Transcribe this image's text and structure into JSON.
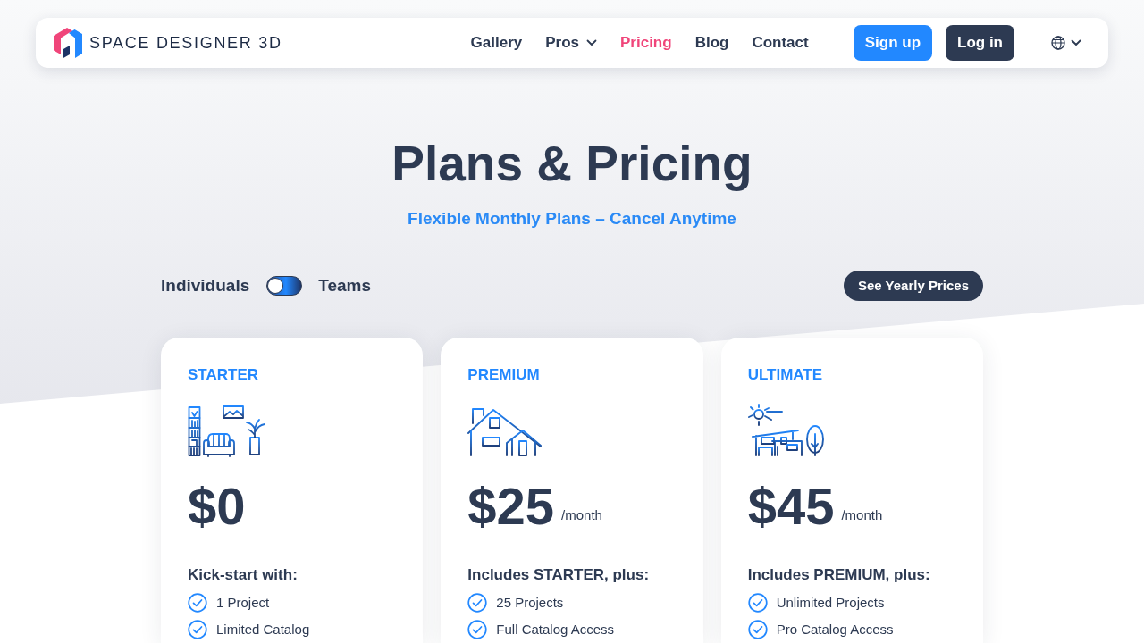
{
  "header": {
    "brand": "SPACE DESIGNER 3D",
    "nav": [
      {
        "label": "Gallery",
        "selected": false,
        "dropdown": false
      },
      {
        "label": "Pros",
        "selected": false,
        "dropdown": true
      },
      {
        "label": "Pricing",
        "selected": true,
        "dropdown": false
      },
      {
        "label": "Blog",
        "selected": false,
        "dropdown": false
      },
      {
        "label": "Contact",
        "selected": false,
        "dropdown": false
      }
    ],
    "buttons": [
      {
        "label": "Sign up",
        "kind": "primary"
      },
      {
        "label": "Log in",
        "kind": "dark"
      }
    ]
  },
  "hero": {
    "title": "Plans & Pricing",
    "subtitle": "Flexible Monthly Plans – Cancel Anytime"
  },
  "plan_toggle": {
    "left_label": "Individuals",
    "right_label": "Teams",
    "on": false
  },
  "yearly_button": "See Yearly Prices",
  "plans": [
    {
      "name": "STARTER",
      "price": "$0",
      "includes": "Kick-start with:",
      "features": [
        "1 Project",
        "Limited Catalog"
      ]
    },
    {
      "name": "PREMIUM",
      "price": "$25",
      "period": "/month",
      "includes": "Includes STARTER, plus:",
      "features": [
        "25 Projects",
        "Full Catalog Access"
      ]
    },
    {
      "name": "ULTIMATE",
      "price": "$45",
      "period": "/month",
      "includes": "Includes PREMIUM, plus:",
      "features": [
        "Unlimited Projects",
        "Pro Catalog Access"
      ]
    }
  ]
}
